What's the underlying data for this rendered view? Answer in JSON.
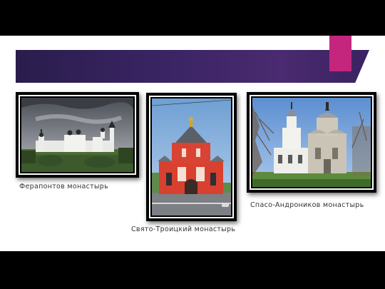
{
  "captions": {
    "ferapontov": "Ферапонтов монастырь",
    "troitsky": "Свято-Троицкий монастырь",
    "andronikov": "Спасо-Андроников монастырь"
  },
  "colors": {
    "banner": "#3b2565",
    "accent": "#c4267e",
    "frame": "#000000"
  }
}
